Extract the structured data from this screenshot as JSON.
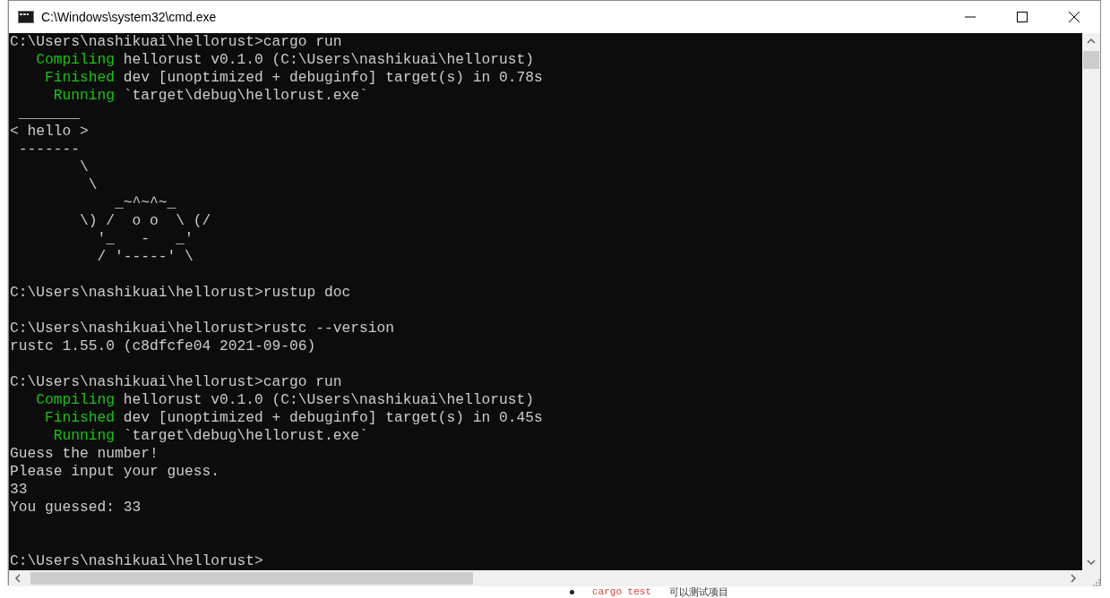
{
  "window": {
    "title": "C:\\Windows\\system32\\cmd.exe"
  },
  "console": {
    "lines": [
      {
        "kind": "plain",
        "text": "C:\\Users\\nashikuai\\hellorust>cargo run"
      },
      {
        "kind": "status",
        "label": "   Compiling",
        "text": " hellorust v0.1.0 (C:\\Users\\nashikuai\\hellorust)"
      },
      {
        "kind": "status",
        "label": "    Finished",
        "text": " dev [unoptimized + debuginfo] target(s) in 0.78s"
      },
      {
        "kind": "status",
        "label": "     Running",
        "text": " `target\\debug\\hellorust.exe`"
      },
      {
        "kind": "plain",
        "text": " _______"
      },
      {
        "kind": "plain",
        "text": "< hello >"
      },
      {
        "kind": "plain",
        "text": " -------"
      },
      {
        "kind": "plain",
        "text": "        \\"
      },
      {
        "kind": "plain",
        "text": "         \\"
      },
      {
        "kind": "plain",
        "text": "            _~^~^~_"
      },
      {
        "kind": "plain",
        "text": "        \\) /  o o  \\ (/"
      },
      {
        "kind": "plain",
        "text": "          '_   -   _'"
      },
      {
        "kind": "plain",
        "text": "          / '-----' \\"
      },
      {
        "kind": "blank"
      },
      {
        "kind": "plain",
        "text": "C:\\Users\\nashikuai\\hellorust>rustup doc"
      },
      {
        "kind": "blank"
      },
      {
        "kind": "plain",
        "text": "C:\\Users\\nashikuai\\hellorust>rustc --version"
      },
      {
        "kind": "plain",
        "text": "rustc 1.55.0 (c8dfcfe04 2021-09-06)"
      },
      {
        "kind": "blank"
      },
      {
        "kind": "plain",
        "text": "C:\\Users\\nashikuai\\hellorust>cargo run"
      },
      {
        "kind": "status",
        "label": "   Compiling",
        "text": " hellorust v0.1.0 (C:\\Users\\nashikuai\\hellorust)"
      },
      {
        "kind": "status",
        "label": "    Finished",
        "text": " dev [unoptimized + debuginfo] target(s) in 0.45s"
      },
      {
        "kind": "status",
        "label": "     Running",
        "text": " `target\\debug\\hellorust.exe`"
      },
      {
        "kind": "plain",
        "text": "Guess the number!"
      },
      {
        "kind": "plain",
        "text": "Please input your guess."
      },
      {
        "kind": "plain",
        "text": "33"
      },
      {
        "kind": "plain",
        "text": "You guessed: 33"
      },
      {
        "kind": "blank"
      },
      {
        "kind": "blank"
      },
      {
        "kind": "plain",
        "text": "C:\\Users\\nashikuai\\hellorust>"
      }
    ]
  },
  "background_page": {
    "bullet": {
      "code": "cargo test",
      "text": "可以测试项目"
    }
  }
}
